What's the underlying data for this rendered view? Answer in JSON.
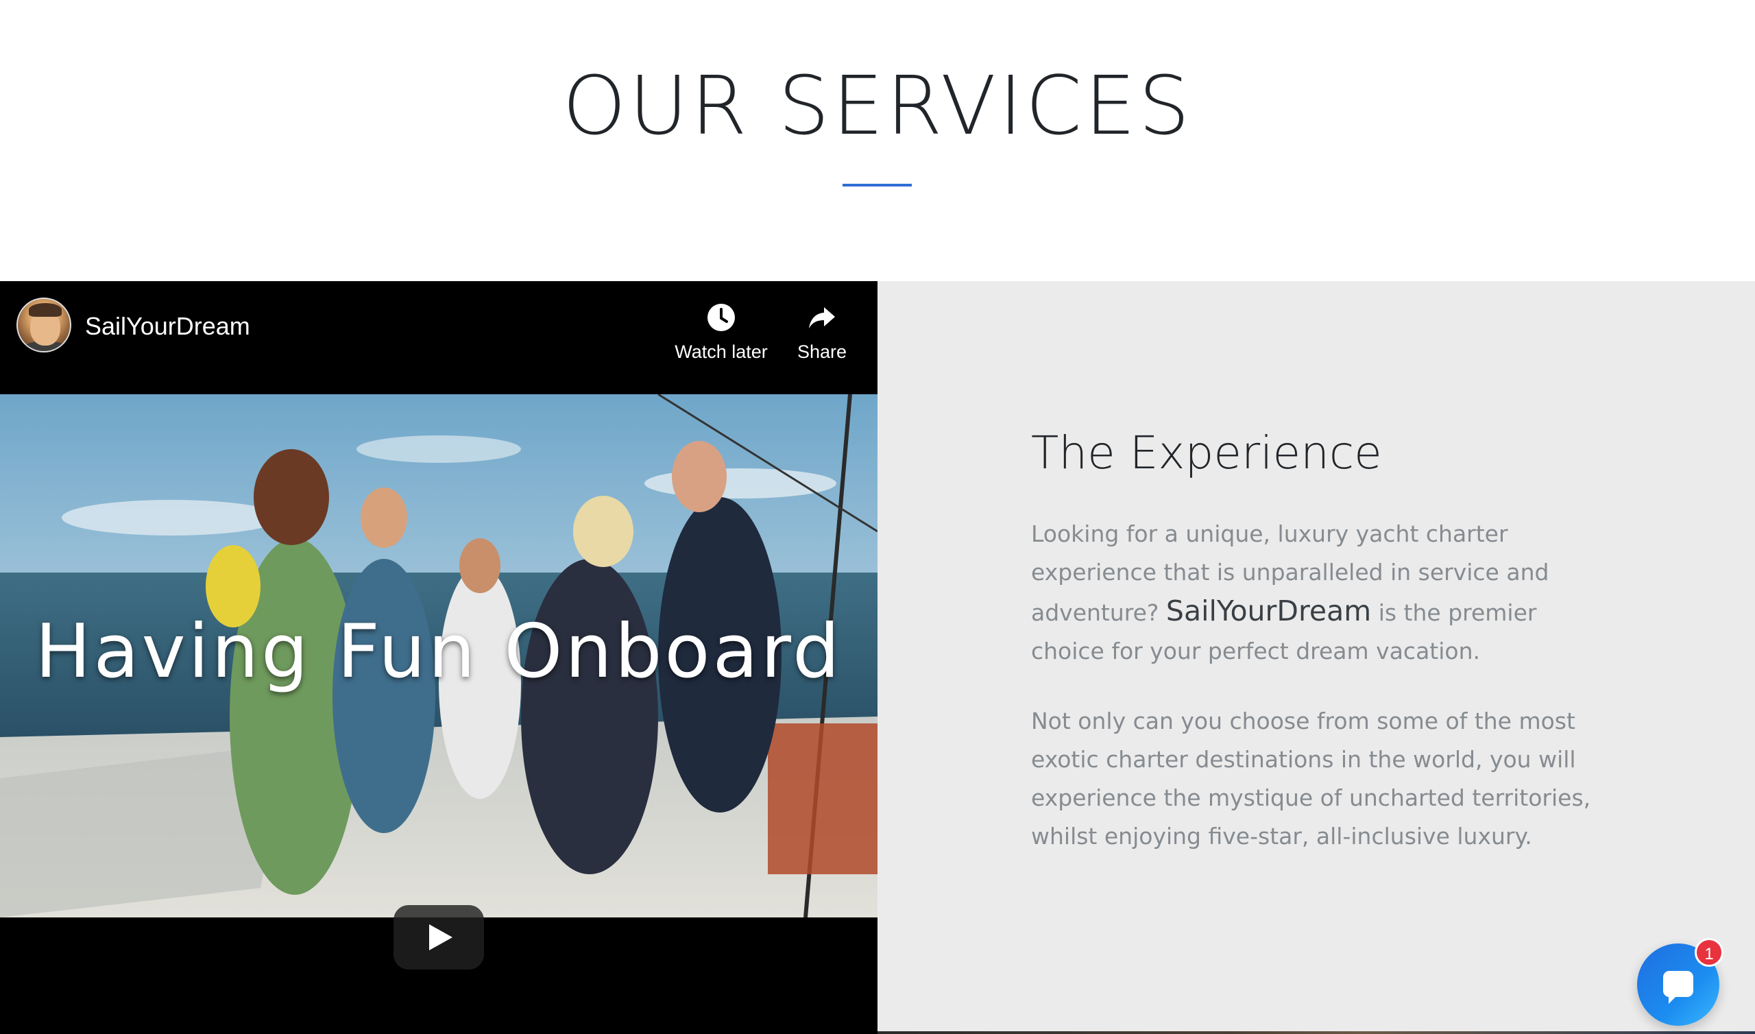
{
  "services": {
    "title": "OUR SERVICES",
    "accent_color": "#2f6fd6"
  },
  "video": {
    "channel_name": "SailYourDream",
    "channel_avatar_icon": "channel-avatar",
    "watch_later_label": "Watch later",
    "share_label": "Share",
    "overlay_title": "Having Fun Onboard",
    "play_icon": "play-icon"
  },
  "experience": {
    "title": "The Experience",
    "para1_before": "Looking for a unique, luxury yacht charter experience that is unparalleled in service and adventure? ",
    "para1_brand": "SailYourDream",
    "para1_after": " is the premier choice for your perfect dream vacation.",
    "para2": "Not only can you choose from some of the most exotic charter destinations in the world, you will experience the mystique of uncharted territories, whilst enjoying five-star, all-inclusive luxury."
  },
  "chat": {
    "icon": "chat-bubble-icon",
    "badge_count": "1",
    "launcher_color": "#1c8cf0",
    "badge_color": "#e8333f"
  }
}
